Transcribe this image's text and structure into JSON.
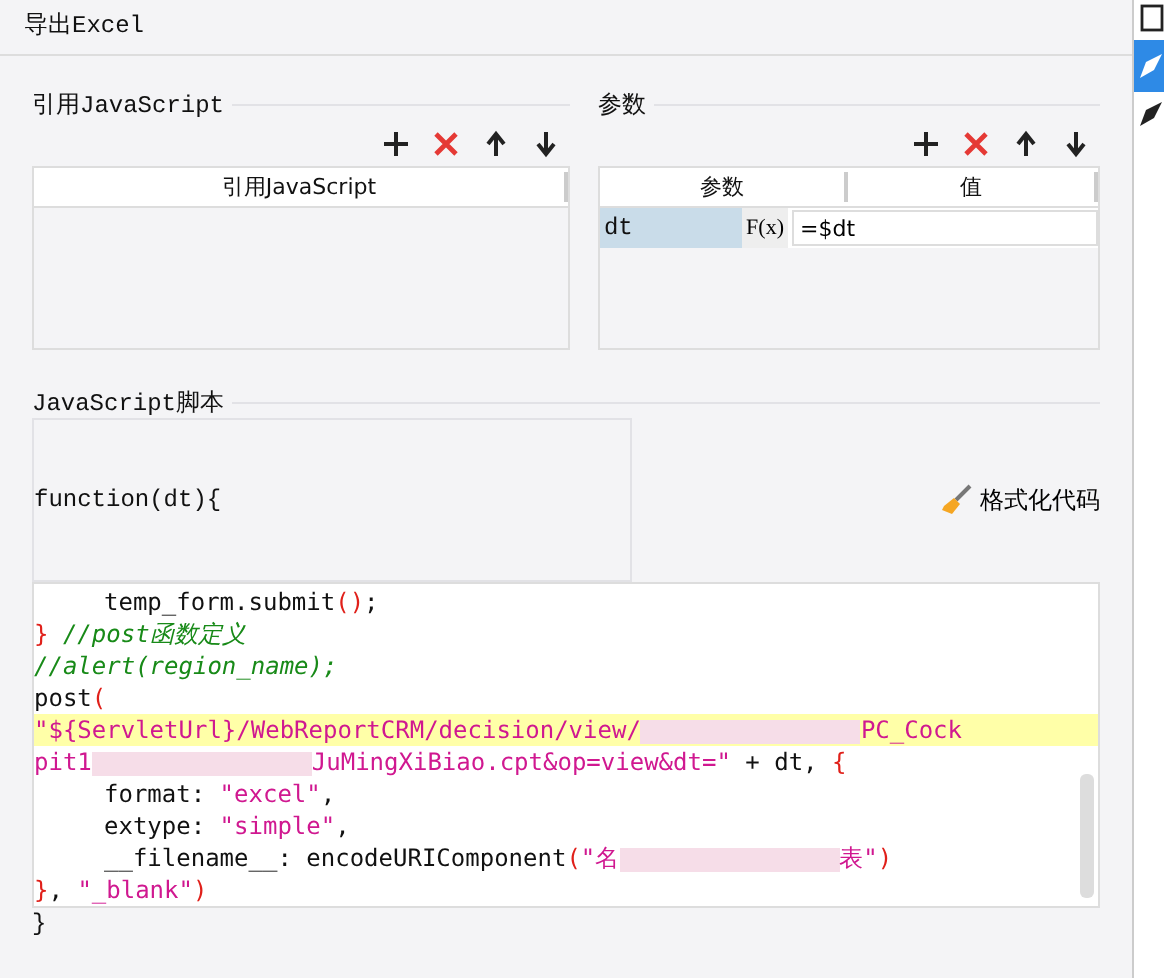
{
  "window": {
    "title": "导出Excel"
  },
  "side_tools": [
    {
      "selected": false
    },
    {
      "selected": true
    },
    {
      "selected": false
    }
  ],
  "scripts_section": {
    "title": "引用JavaScript",
    "table": {
      "columns": [
        "引用JavaScript"
      ]
    }
  },
  "params_section": {
    "title": "参数",
    "table": {
      "columns": [
        "参数",
        "值"
      ],
      "rows": [
        {
          "name": "dt",
          "formula_button": "F(x)",
          "value": "=$dt",
          "selected": true
        }
      ]
    }
  },
  "script_section": {
    "title": "JavaScript脚本",
    "signature": "function(dt){",
    "format_button": "格式化代码",
    "code": [
      {
        "indent": true,
        "highlight": false,
        "tokens": [
          {
            "kind": "plain",
            "text": "temp_form.submit"
          },
          {
            "kind": "punct",
            "text": "()"
          },
          {
            "kind": "plain",
            "text": ";"
          }
        ]
      },
      {
        "indent": false,
        "highlight": false,
        "tokens": [
          {
            "kind": "punct",
            "text": "}"
          },
          {
            "kind": "comment",
            "text": " //post函数定义"
          }
        ]
      },
      {
        "indent": false,
        "highlight": false,
        "tokens": [
          {
            "kind": "comment",
            "text": "//alert(region_name);"
          }
        ]
      },
      {
        "indent": false,
        "highlight": false,
        "tokens": [
          {
            "kind": "plain",
            "text": "post"
          },
          {
            "kind": "punct",
            "text": "("
          }
        ]
      },
      {
        "indent": false,
        "highlight": true,
        "tokens": [
          {
            "kind": "string",
            "text": "\"${ServletUrl}/WebReportCRM/decision/view/"
          },
          {
            "kind": "blur"
          },
          {
            "kind": "string",
            "text": "PC_Cock"
          }
        ]
      },
      {
        "indent": false,
        "highlight": false,
        "tokens": [
          {
            "kind": "string",
            "text": "pit1"
          },
          {
            "kind": "blur"
          },
          {
            "kind": "string",
            "text": "JuMingXiBiao.cpt&op=view&dt=\""
          },
          {
            "kind": "plain",
            "text": " + dt, "
          },
          {
            "kind": "punct",
            "text": "{"
          }
        ]
      },
      {
        "indent": true,
        "highlight": false,
        "tokens": [
          {
            "kind": "plain",
            "text": "format: "
          },
          {
            "kind": "string",
            "text": "\"excel\""
          },
          {
            "kind": "plain",
            "text": ","
          }
        ]
      },
      {
        "indent": true,
        "highlight": false,
        "tokens": [
          {
            "kind": "plain",
            "text": "extype: "
          },
          {
            "kind": "string",
            "text": "\"simple\""
          },
          {
            "kind": "plain",
            "text": ","
          }
        ]
      },
      {
        "indent": true,
        "highlight": false,
        "tokens": [
          {
            "kind": "plain",
            "text": "__filename__: encodeURIComponent"
          },
          {
            "kind": "punct",
            "text": "("
          },
          {
            "kind": "string",
            "text": "\"名"
          },
          {
            "kind": "blur"
          },
          {
            "kind": "string",
            "text": "表\""
          },
          {
            "kind": "punct",
            "text": ")"
          }
        ]
      },
      {
        "indent": false,
        "highlight": false,
        "tokens": [
          {
            "kind": "punct",
            "text": "}"
          },
          {
            "kind": "plain",
            "text": ", "
          },
          {
            "kind": "string",
            "text": "\"_blank\""
          },
          {
            "kind": "punct",
            "text": ")"
          }
        ]
      }
    ],
    "closing": "}"
  }
}
